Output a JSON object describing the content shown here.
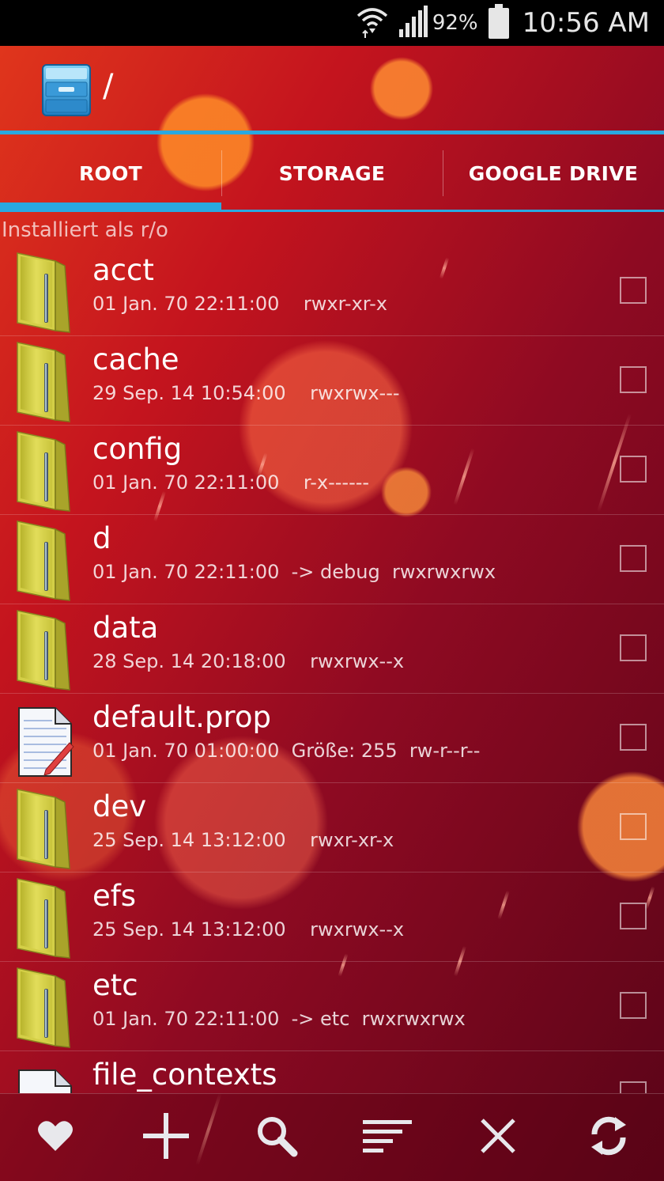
{
  "status_bar": {
    "battery_percent": "92%",
    "time": "10:56 AM",
    "icons": [
      "wifi-icon",
      "signal-icon",
      "battery-icon"
    ]
  },
  "header": {
    "app_icon": "file-cabinet-icon",
    "path": "/"
  },
  "tabs": [
    {
      "label": "ROOT",
      "active": true
    },
    {
      "label": "STORAGE",
      "active": false
    },
    {
      "label": "GOOGLE DRIVE",
      "active": false
    }
  ],
  "mount_info": "Installiert als r/o",
  "files": [
    {
      "name": "acct",
      "meta": "01 Jan. 70 22:11:00    rwxr-xr-x",
      "type": "folder"
    },
    {
      "name": "cache",
      "meta": "29 Sep. 14 10:54:00    rwxrwx---",
      "type": "folder"
    },
    {
      "name": "config",
      "meta": "01 Jan. 70 22:11:00    r-x------",
      "type": "folder"
    },
    {
      "name": "d",
      "meta": "01 Jan. 70 22:11:00  -> debug  rwxrwxrwx",
      "type": "folder"
    },
    {
      "name": "data",
      "meta": "28 Sep. 14 20:18:00    rwxrwx--x",
      "type": "folder"
    },
    {
      "name": "default.prop",
      "meta": "01 Jan. 70 01:00:00  Größe: 255  rw-r--r--",
      "type": "text-file"
    },
    {
      "name": "dev",
      "meta": "25 Sep. 14 13:12:00    rwxr-xr-x",
      "type": "folder"
    },
    {
      "name": "efs",
      "meta": "25 Sep. 14 13:12:00    rwxrwx--x",
      "type": "folder"
    },
    {
      "name": "etc",
      "meta": "01 Jan. 70 22:11:00  -> etc  rwxrwxrwx",
      "type": "folder"
    },
    {
      "name": "file_contexts",
      "meta": "",
      "type": "file"
    }
  ],
  "toolbar": [
    {
      "icon": "heart-icon",
      "name": "favorites-button"
    },
    {
      "icon": "plus-icon",
      "name": "add-button"
    },
    {
      "icon": "search-icon",
      "name": "search-button"
    },
    {
      "icon": "sort-icon",
      "name": "sort-button"
    },
    {
      "icon": "close-icon",
      "name": "close-button"
    },
    {
      "icon": "refresh-icon",
      "name": "refresh-button"
    }
  ],
  "colors": {
    "accent_blue": "#2aa8e0",
    "folder_yellow": "#d8d44a",
    "status_bar": "#000000"
  }
}
